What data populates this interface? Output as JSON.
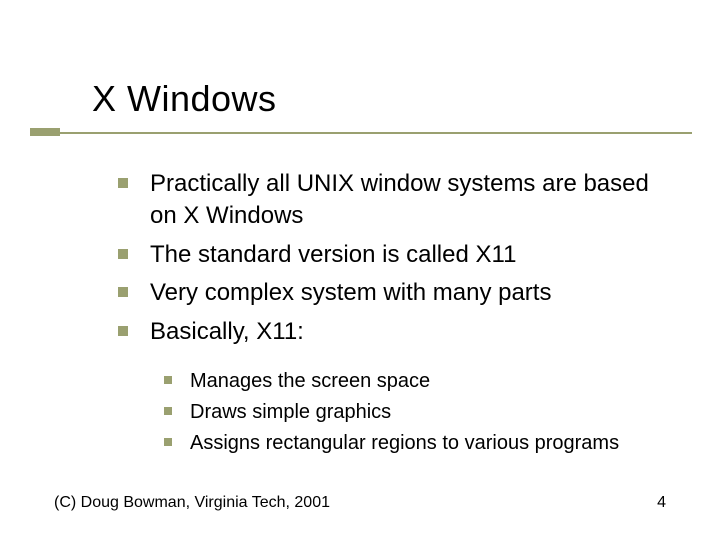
{
  "title": "X Windows",
  "bullets": [
    "Practically all UNIX window systems are based on X Windows",
    "The standard version is called X11",
    "Very complex system with many parts",
    "Basically, X11:"
  ],
  "sub_bullets": [
    "Manages the screen space",
    "Draws simple graphics",
    "Assigns rectangular regions to various programs"
  ],
  "footer": {
    "copyright": "(C) Doug Bowman, Virginia Tech, 2001",
    "page_number": "4"
  },
  "colors": {
    "accent": "#9aa070"
  }
}
